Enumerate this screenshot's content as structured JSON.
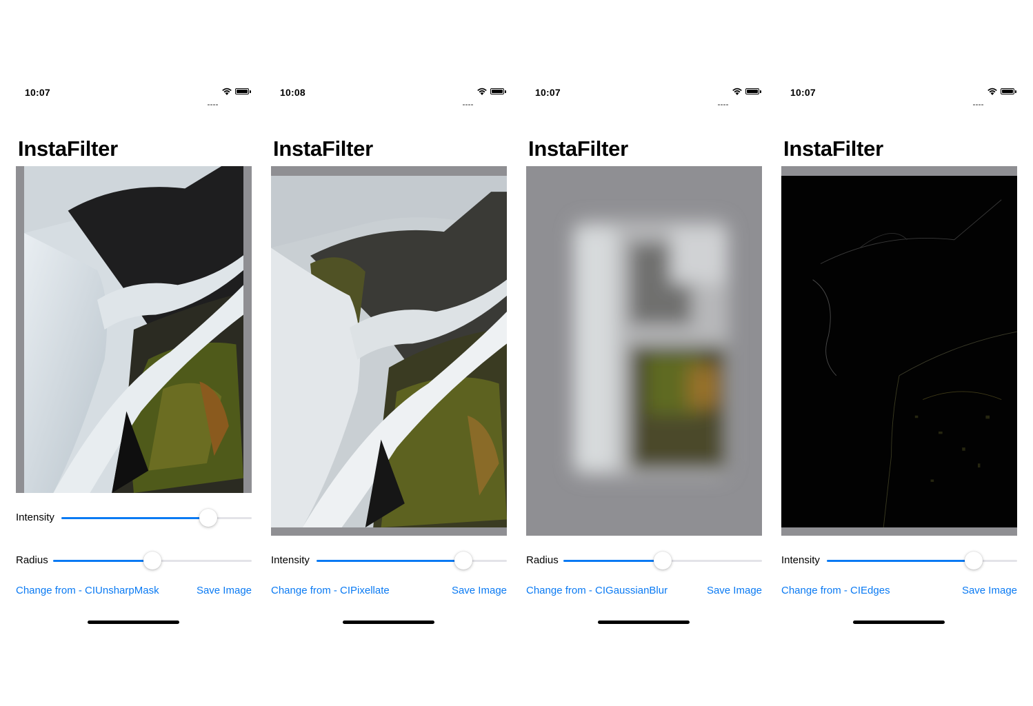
{
  "screens": [
    {
      "status": {
        "time": "10:07"
      },
      "title": "InstaFilter",
      "filter_effect": "unsharp-mask",
      "sliders": [
        {
          "label": "Intensity",
          "value": 0.77
        },
        {
          "label": "Radius",
          "value": 0.5
        }
      ],
      "change_button": "Change from - CIUnsharpMask",
      "save_button": "Save Image"
    },
    {
      "status": {
        "time": "10:08"
      },
      "title": "InstaFilter",
      "filter_effect": "pixellate",
      "sliders": [
        {
          "label": "Intensity",
          "value": 0.77
        }
      ],
      "change_button": "Change from - CIPixellate",
      "save_button": "Save Image"
    },
    {
      "status": {
        "time": "10:07"
      },
      "title": "InstaFilter",
      "filter_effect": "gaussian-blur",
      "sliders": [
        {
          "label": "Radius",
          "value": 0.5
        }
      ],
      "change_button": "Change from - CIGaussianBlur",
      "save_button": "Save Image"
    },
    {
      "status": {
        "time": "10:07"
      },
      "title": "InstaFilter",
      "filter_effect": "edges",
      "sliders": [
        {
          "label": "Intensity",
          "value": 0.77
        }
      ],
      "change_button": "Change from - CIEdges",
      "save_button": "Save Image"
    }
  ],
  "colors": {
    "accent": "#0a7af3",
    "image_background": "#8f8f93",
    "track": "#e3e3e8"
  },
  "icons": [
    "cellular-signal-icon",
    "wifi-icon",
    "battery-icon"
  ]
}
